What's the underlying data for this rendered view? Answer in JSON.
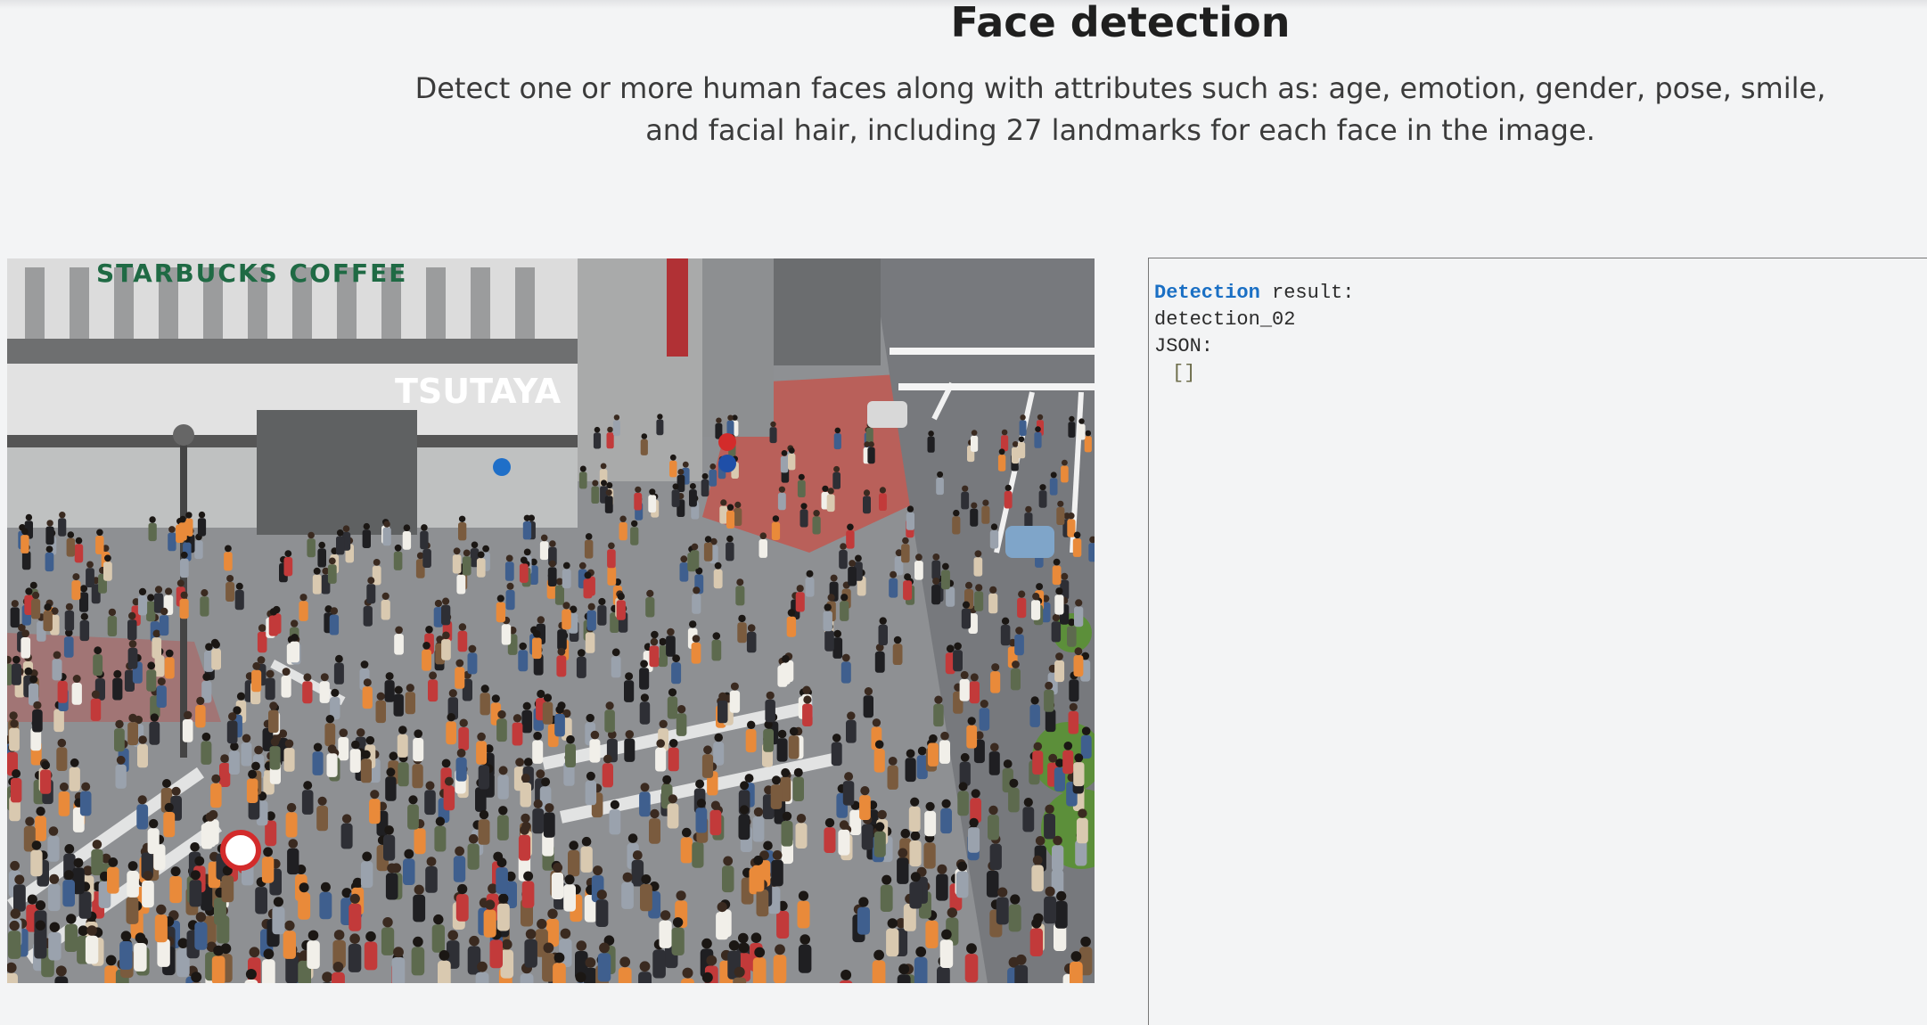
{
  "header": {
    "title": "Face detection",
    "subtitle": "Detect one or more human faces along with attributes such as: age, emotion, gender, pose, smile, and facial hair, including 27 landmarks for each face in the image."
  },
  "photo": {
    "signs": {
      "store_name": "STARBUCKS COFFEE",
      "building_sign": "TSUTAYA"
    }
  },
  "result": {
    "label_keyword": "Detection",
    "label_rest": " result:",
    "detection_id": "detection_02",
    "json_label": "JSON:",
    "json_value": "[]"
  },
  "colors": {
    "background": "#f3f4f5",
    "keyword": "#1a6fc4",
    "text": "#2b2b2b"
  }
}
